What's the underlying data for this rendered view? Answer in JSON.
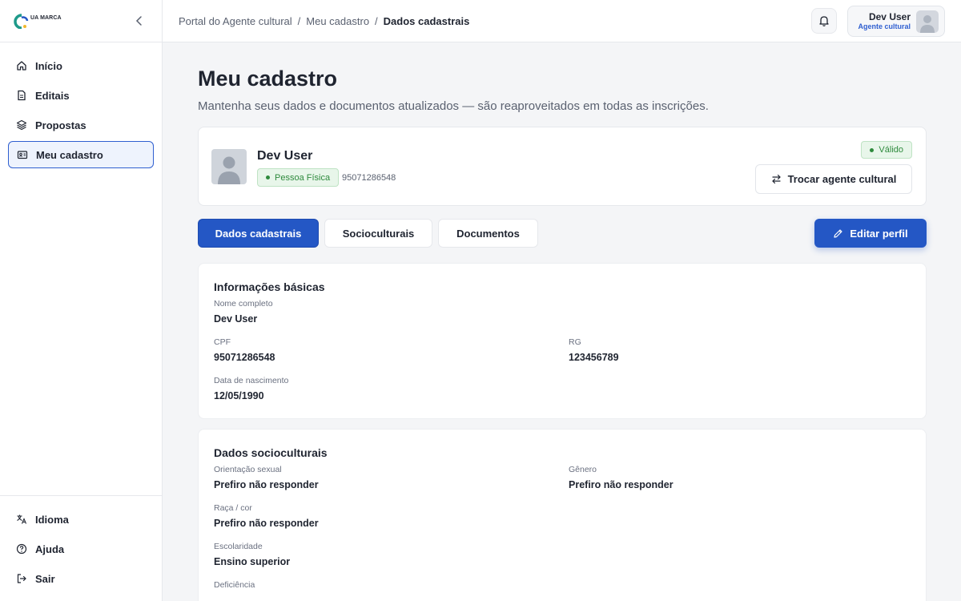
{
  "brand": {
    "logo_text": "UA MARCA"
  },
  "sidebar": {
    "items": [
      {
        "label": "Início",
        "icon": "home-icon"
      },
      {
        "label": "Editais",
        "icon": "document-icon"
      },
      {
        "label": "Propostas",
        "icon": "layers-icon"
      },
      {
        "label": "Meu cadastro",
        "icon": "id-card-icon",
        "active": true
      }
    ],
    "bottom_items": [
      {
        "label": "Idioma",
        "icon": "translate-icon"
      },
      {
        "label": "Ajuda",
        "icon": "help-icon"
      },
      {
        "label": "Sair",
        "icon": "logout-icon"
      }
    ]
  },
  "breadcrumb": {
    "item1": "Portal do Agente cultural",
    "item2": "Meu cadastro",
    "current": "Dados cadastrais",
    "separator": "/"
  },
  "user": {
    "name": "Dev User",
    "role": "Agente cultural"
  },
  "page": {
    "title": "Meu cadastro",
    "subtitle": "Mantenha seus dados e documentos atualizados — são reaproveitados em todas as inscrições."
  },
  "profile": {
    "name": "Dev User",
    "type_badge": "Pessoa Física",
    "cpf": "95071286548",
    "status": "Válido",
    "switch_label": "Trocar agente cultural"
  },
  "tabs": {
    "dados": "Dados cadastrais",
    "socio": "Socioculturais",
    "docs": "Documentos"
  },
  "edit_label": "Editar perfil",
  "basic": {
    "title": "Informações básicas",
    "nome_label": "Nome completo",
    "nome": "Dev User",
    "cpf_label": "CPF",
    "cpf": "95071286548",
    "rg_label": "RG",
    "rg": "123456789",
    "nasc_label": "Data de nascimento",
    "nasc": "12/05/1990"
  },
  "socio": {
    "title": "Dados socioculturais",
    "orient_label": "Orientação sexual",
    "orient": "Prefiro não responder",
    "genero_label": "Gênero",
    "genero": "Prefiro não responder",
    "raca_label": "Raça / cor",
    "raca": "Prefiro não responder",
    "escol_label": "Escolaridade",
    "escol": "Ensino superior",
    "defic_label": "Deficiência"
  },
  "colors": {
    "primary": "#2457c5",
    "success": "#2e8a3d",
    "success_bg": "#e8f6ea"
  }
}
